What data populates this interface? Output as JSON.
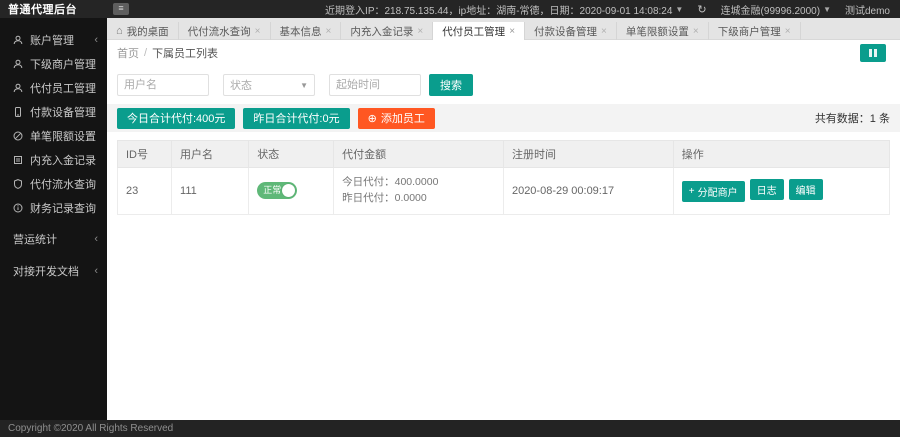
{
  "header": {
    "brand": "普通代理后台",
    "login_info": "近期登入IP：218.75.135.44，ip地址：湖南-常德，日期：2020-09-01 14:08:24",
    "org": "连城金融(99996.2000)",
    "user": "测试demo"
  },
  "icons": {
    "hamburger": "≡",
    "caret_down": "▼",
    "refresh": "↻",
    "home": "⌂",
    "close": "×",
    "chevron_left": "‹",
    "plus_circle": "⊕",
    "plus": "+"
  },
  "sidebar": {
    "items": [
      {
        "key": "account-mgmt",
        "label": "账户管理",
        "icon": "user",
        "chevron": true
      },
      {
        "key": "sub-merchants",
        "label": "下级商户管理",
        "icon": "user"
      },
      {
        "key": "pay-employees",
        "label": "代付员工管理",
        "icon": "user"
      },
      {
        "key": "pay-devices",
        "label": "付款设备管理",
        "icon": "device"
      },
      {
        "key": "single-limit",
        "label": "单笔限额设置",
        "icon": "ban"
      },
      {
        "key": "recharge-record",
        "label": "内充入金记录",
        "icon": "doc"
      },
      {
        "key": "pay-flow-query",
        "label": "代付流水查询",
        "icon": "shield"
      },
      {
        "key": "finance-record",
        "label": "财务记录查询",
        "icon": "info"
      },
      {
        "key": "operation-stats",
        "label": "营运统计",
        "chevron": true,
        "section": true
      },
      {
        "key": "dev-docs",
        "label": "对接开发文档",
        "chevron": true,
        "section": true
      }
    ]
  },
  "tabs": [
    {
      "key": "desktop",
      "label": "我的桌面",
      "home": true
    },
    {
      "key": "pay-flow",
      "label": "代付流水查询",
      "closable": true
    },
    {
      "key": "basic-info",
      "label": "基本信息",
      "closable": true
    },
    {
      "key": "recharge",
      "label": "内充入金记录",
      "closable": true
    },
    {
      "key": "pay-employees",
      "label": "代付员工管理",
      "closable": true,
      "active": true
    },
    {
      "key": "pay-devices",
      "label": "付款设备管理",
      "closable": true
    },
    {
      "key": "single-limit",
      "label": "单笔限额设置",
      "closable": true
    },
    {
      "key": "sub-merchants",
      "label": "下级商户管理",
      "closable": true
    }
  ],
  "breadcrumb": {
    "home": "首页",
    "sep": "/",
    "current": "下属员工列表"
  },
  "filters": {
    "username_placeholder": "用户名",
    "status_placeholder": "状态",
    "time_placeholder": "起始时间",
    "search_label": "搜索"
  },
  "toolbar": {
    "today_total": "今日合计代付:400元",
    "yesterday_total": "昨日合计代付:0元",
    "add_employee": "添加员工",
    "total_count": "共有数据：1 条"
  },
  "table": {
    "headers": [
      "ID号",
      "用户名",
      "状态",
      "代付金额",
      "注册时间",
      "操作"
    ],
    "col_widths": [
      "7%",
      "10%",
      "11%",
      "22%",
      "22%",
      "28%"
    ],
    "rows": [
      {
        "id": "23",
        "username": "111",
        "status_label": "正常",
        "status_on": true,
        "amount_line1": "今日代付：400.0000",
        "amount_line2": "昨日代付：0.0000",
        "reg_time": "2020-08-29 00:09:17",
        "actions": [
          {
            "key": "assign-merchant",
            "label": "分配商户",
            "plus": true
          },
          {
            "key": "log",
            "label": "日志"
          },
          {
            "key": "edit",
            "label": "编辑"
          }
        ]
      }
    ]
  },
  "footer": {
    "copyright": "Copyright ©2020 All Rights Reserved"
  },
  "colors": {
    "teal": "#0a9d8d",
    "orange": "#ff5722",
    "toggle_green": "#5fb878"
  }
}
